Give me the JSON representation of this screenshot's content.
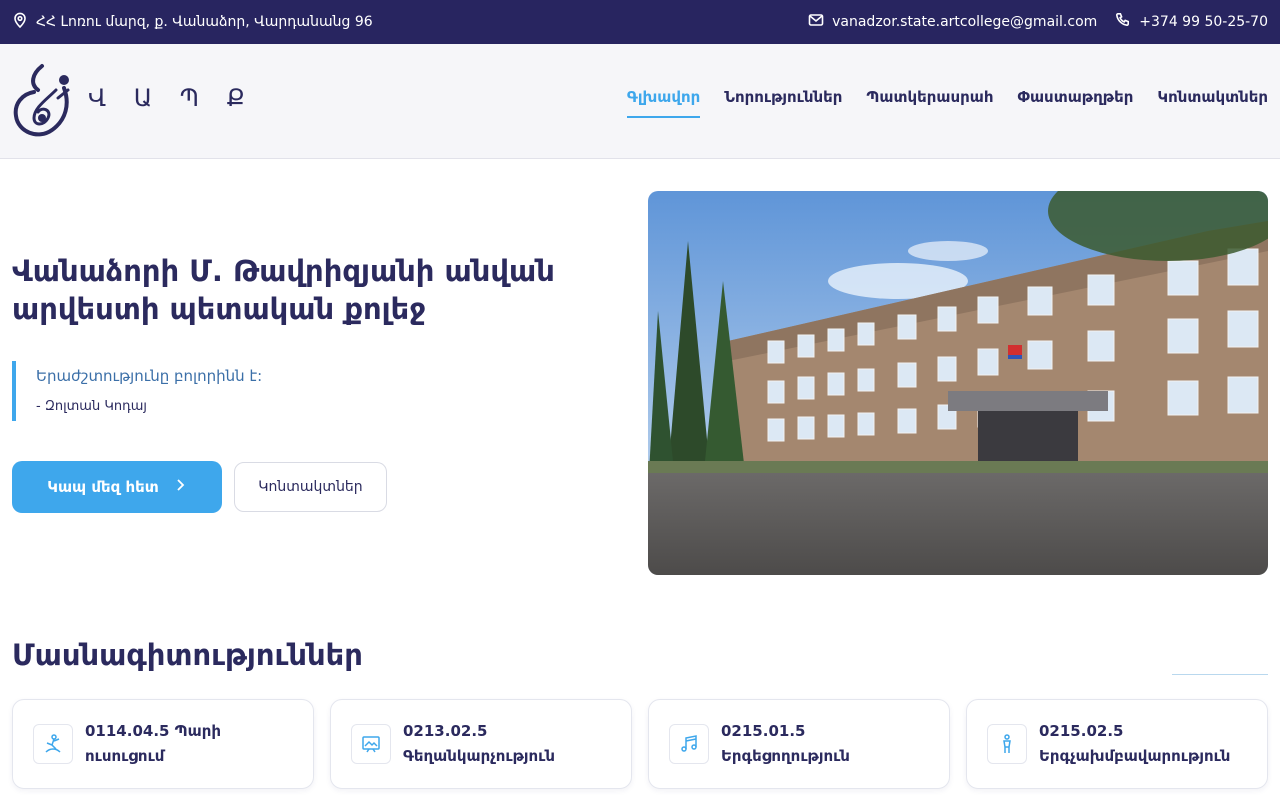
{
  "topbar": {
    "address": "ՀՀ Լոռու մարզ, ք. Վանաձոր, Վարդանանց 96",
    "email": "vanadzor.state.artcollege@gmail.com",
    "phone": "+374 99 50-25-70",
    "background": "#282560"
  },
  "header": {
    "logo_text": "Վ Ա Պ Ք",
    "nav": [
      {
        "label": "Գլխավոր",
        "active": true
      },
      {
        "label": "Նորություններ",
        "active": false
      },
      {
        "label": "Պատկերասրահ",
        "active": false
      },
      {
        "label": "Փաստաթղթեր",
        "active": false
      },
      {
        "label": "Կոնտակտներ",
        "active": false
      }
    ]
  },
  "hero": {
    "title": "Վանաձորի Մ. Թավրիզյանի անվան արվեստի պետական քոլեջ",
    "quote": "Երաժշտությունը բոլորինն է:",
    "quote_author": "- Զոլտան Կոդայ",
    "primary_button": "Կապ մեզ հետ",
    "secondary_button": "Կոնտակտներ"
  },
  "specialties": {
    "title": "Մասնագիտություններ",
    "cards": [
      {
        "label": "0114.04.5 Պարի ուսուցում",
        "icon": "dance-icon"
      },
      {
        "label": "0213.02.5 Գեղանկարչություն",
        "icon": "painting-icon"
      },
      {
        "label": "0215.01.5 Երգեցողություն",
        "icon": "music-notes-icon"
      },
      {
        "label": "0215.02.5 Երգչախմբավարություն",
        "icon": "conductor-icon"
      }
    ]
  },
  "colors": {
    "accent": "#3ea7ec",
    "brand": "#2b2a5e"
  }
}
